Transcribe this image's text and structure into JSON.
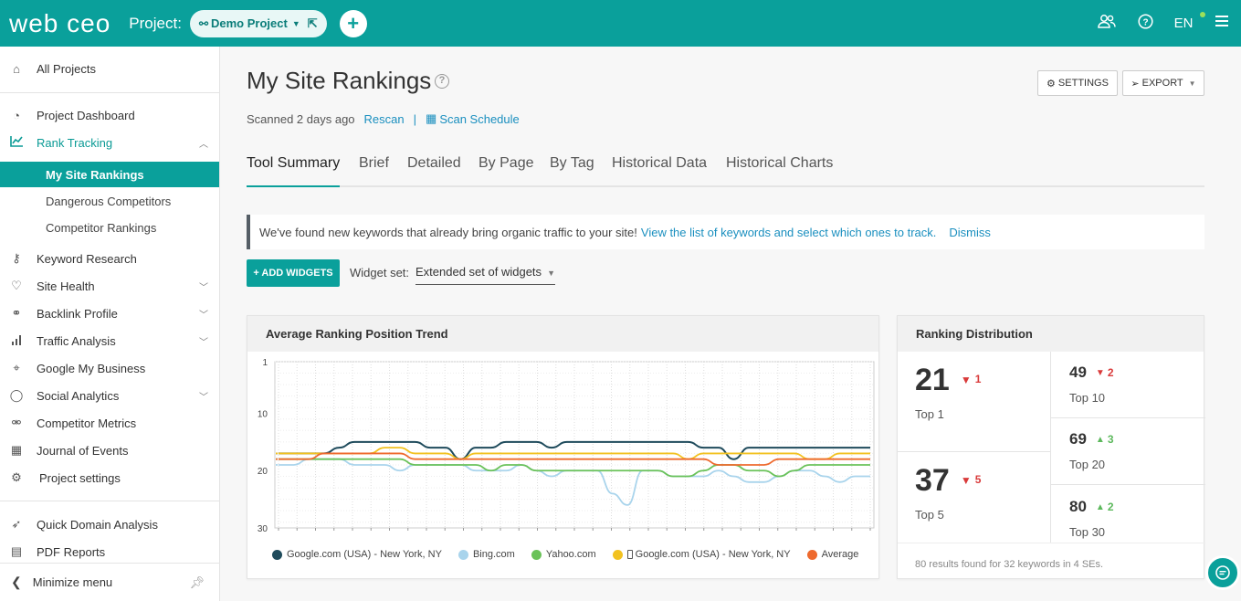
{
  "header": {
    "logo": "web ceo",
    "project_label": "Project:",
    "project_name": "Demo Project",
    "language": "EN"
  },
  "sidebar": {
    "all_projects": "All Projects",
    "items": [
      {
        "label": "Project Dashboard",
        "icon": "dashboard-icon"
      },
      {
        "label": "Rank Tracking",
        "icon": "rank-chart-icon"
      },
      {
        "label": "Keyword Research",
        "icon": "key-icon"
      },
      {
        "label": "Site Health",
        "icon": "heartbeat-icon"
      },
      {
        "label": "Backlink Profile",
        "icon": "link-icon"
      },
      {
        "label": "Traffic Analysis",
        "icon": "bar-chart-icon"
      },
      {
        "label": "Google My Business",
        "icon": "map-pin-icon"
      },
      {
        "label": "Social Analytics",
        "icon": "chat-bubble-icon"
      },
      {
        "label": "Competitor Metrics",
        "icon": "binoculars-icon"
      },
      {
        "label": "Journal of Events",
        "icon": "calendar-icon"
      },
      {
        "label": "Project settings",
        "icon": "gear-icon"
      },
      {
        "label": "Quick Domain Analysis",
        "icon": "rocket-icon"
      },
      {
        "label": "PDF Reports",
        "icon": "pdf-icon"
      }
    ],
    "sub_items": [
      "My Site Rankings",
      "Dangerous Competitors",
      "Competitor Rankings"
    ],
    "minimize": "Minimize menu"
  },
  "main": {
    "title": "My Site Rankings",
    "settings_btn": "SETTINGS",
    "export_btn": "EXPORT",
    "scanned": "Scanned 2 days ago",
    "rescan": "Rescan",
    "scan_schedule": "Scan Schedule",
    "tabs": [
      "Tool Summary",
      "Brief",
      "Detailed",
      "By Page",
      "By Tag",
      "Historical Data",
      "Historical Charts"
    ],
    "notice_text": "We've found new keywords that already bring organic traffic to your site!",
    "notice_link": "View the list of keywords and select which ones to track.",
    "notice_dismiss": "Dismiss",
    "add_widgets": "+ ADD WIDGETS",
    "widget_set_label": "Widget set:",
    "widget_set_value": "Extended set of widgets"
  },
  "trend_card": {
    "title": "Average Ranking Position Trend"
  },
  "chart_data": {
    "type": "line",
    "title": "Average Ranking Position Trend",
    "ylim": [
      1,
      30
    ],
    "y_inverted": true,
    "yticks": [
      "1",
      "10",
      "20",
      "30"
    ],
    "series": [
      {
        "name": "Google.com (USA) - New York, NY",
        "color": "#1f4b5c",
        "values": [
          17,
          17,
          17,
          17,
          16,
          15,
          15,
          15,
          15,
          15,
          16,
          16,
          18,
          16,
          16,
          15,
          15,
          15,
          16,
          15,
          15,
          15,
          15,
          15,
          15,
          15,
          15,
          15,
          16,
          16,
          18,
          16,
          16,
          16,
          16,
          16,
          16,
          16,
          16,
          16
        ]
      },
      {
        "name": "Bing.com",
        "color": "#a9d4ec",
        "values": [
          19,
          19,
          18,
          18,
          18,
          19,
          19,
          19,
          20,
          19,
          19,
          19,
          19,
          20,
          20,
          20,
          19,
          20,
          21,
          20,
          20,
          20,
          24,
          26,
          20,
          20,
          21,
          21,
          21,
          20,
          21,
          22,
          22,
          21,
          20,
          20,
          21,
          22,
          21,
          21
        ]
      },
      {
        "name": "Yahoo.com",
        "color": "#6ac259",
        "values": [
          18,
          18,
          18,
          18,
          18,
          18,
          18,
          18,
          18,
          19,
          19,
          19,
          19,
          19,
          20,
          19,
          19,
          20,
          20,
          20,
          20,
          20,
          20,
          20,
          20,
          20,
          21,
          21,
          20,
          19,
          19,
          20,
          20,
          21,
          20,
          19,
          19,
          19,
          19,
          19
        ]
      },
      {
        "name": "Google.com (USA) - New York, NY",
        "color": "#f2c220",
        "values": [
          17,
          17,
          17,
          17,
          17,
          17,
          17,
          16,
          16,
          17,
          17,
          17,
          18,
          17,
          17,
          17,
          17,
          17,
          17,
          17,
          17,
          17,
          17,
          17,
          17,
          17,
          17,
          18,
          17,
          17,
          17,
          17,
          17,
          17,
          17,
          18,
          18,
          17,
          17,
          17
        ]
      },
      {
        "name": "Average",
        "color": "#ee6a2e",
        "values": [
          18,
          18,
          18,
          17,
          17,
          17,
          17,
          17,
          17,
          18,
          18,
          18,
          18,
          18,
          18,
          18,
          18,
          18,
          18,
          18,
          18,
          18,
          18,
          18,
          18,
          18,
          18,
          18,
          18,
          19,
          19,
          19,
          19,
          18,
          18,
          18,
          18,
          18,
          18,
          18
        ]
      }
    ]
  },
  "legend_icons": {
    "mobile": "mobile-phone-icon"
  },
  "distribution": {
    "title": "Ranking Distribution",
    "cells": [
      {
        "value": "21",
        "delta": "1",
        "dir": "down",
        "label": "Top 1"
      },
      {
        "value": "37",
        "delta": "5",
        "dir": "down",
        "label": "Top 5"
      },
      {
        "value": "49",
        "delta": "2",
        "dir": "down",
        "label": "Top 10"
      },
      {
        "value": "69",
        "delta": "3",
        "dir": "up",
        "label": "Top 20"
      },
      {
        "value": "80",
        "delta": "2",
        "dir": "up",
        "label": "Top 30"
      }
    ],
    "footer": "80 results found for 32 keywords in 4 SEs.",
    "colors": {
      "down": "#d93a3a",
      "up": "#5cb85c"
    }
  }
}
